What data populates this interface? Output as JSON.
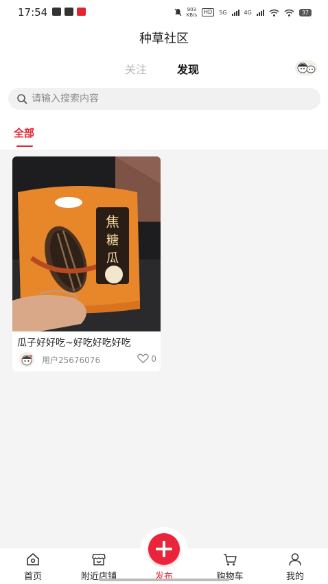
{
  "status_bar": {
    "time": "17:54",
    "net_speed_value": "903",
    "net_speed_unit": "KB/s",
    "hd_label": "HD",
    "sig1_label": "5G",
    "sig2_label": "4G",
    "battery": "37"
  },
  "header": {
    "title": "种草社区",
    "tab_follow": "关注",
    "tab_discover": "发现"
  },
  "search": {
    "placeholder": "请输入搜索内容"
  },
  "categories": {
    "all": "全部"
  },
  "posts": [
    {
      "title": "瓜子好好吃~好吃好吃好吃",
      "user": "用户25676076",
      "likes": "0",
      "image_text": "焦糖瓜子"
    }
  ],
  "nav": {
    "home": "首页",
    "nearby": "附近店铺",
    "publish": "发布",
    "cart": "购物车",
    "mine": "我的"
  },
  "colors": {
    "accent": "#e3232f",
    "publish_button": "#e8253a",
    "feed_background": "#f4f4f4"
  }
}
